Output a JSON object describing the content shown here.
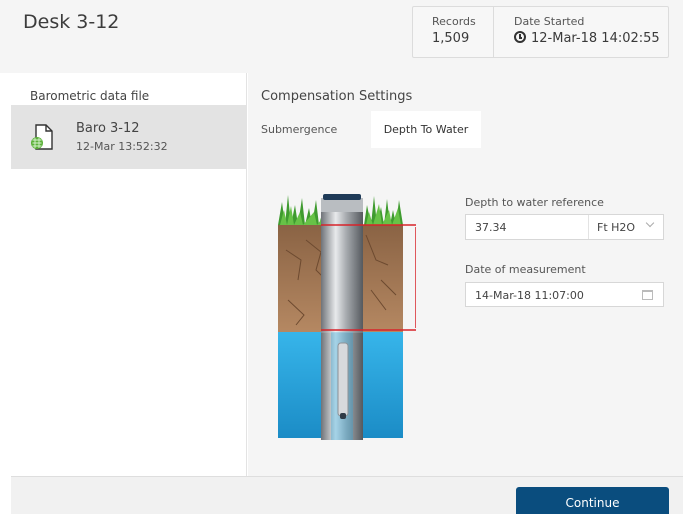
{
  "header": {
    "title": "Desk 3-12",
    "records_label": "Records",
    "records_value": "1,509",
    "date_started_label": "Date Started",
    "date_started_value": "12-Mar-18 14:02:55",
    "date_icon": "clock-icon"
  },
  "left_panel": {
    "heading": "Barometric data file",
    "files": [
      {
        "name": "Baro 3-12",
        "date": "12-Mar 13:52:32",
        "icon": "baro-file-icon"
      }
    ]
  },
  "right_panel": {
    "heading": "Compensation Settings",
    "tabs": [
      {
        "label": "Submergence",
        "selected": false
      },
      {
        "label": "Depth To Water",
        "selected": true
      }
    ],
    "depth_label": "Depth to water reference",
    "depth_value": "37.34",
    "unit_value": "Ft H2O",
    "date_label": "Date of measurement",
    "date_value": "14-Mar-18 11:07:00"
  },
  "footer": {
    "continue_label": "Continue"
  },
  "colors": {
    "accent": "#0a4d7e",
    "selected_item": "#e3e3e3",
    "water": "#2aa9e0",
    "soil": "#a67a55",
    "grass": "#3f9b2f",
    "depth_marker": "#d8232a"
  }
}
